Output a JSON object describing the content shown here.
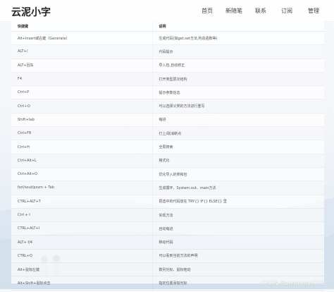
{
  "header": {
    "site_title": "云泥小字",
    "nav": [
      "首页",
      "新随笔",
      "联系",
      "订阅",
      "管理"
    ]
  },
  "table": {
    "columns": [
      "快捷键",
      "说明"
    ],
    "rows": [
      [
        "Alt+Insert或右键（Generate）",
        "生成代码(如get,set方法,构造函数等)"
      ],
      [
        "ALT+/",
        "代码提示"
      ],
      [
        "ALT+回车",
        "导入包,自动修正"
      ],
      [
        "F4",
        "打开类型层次结构"
      ],
      [
        "Ctrl+P",
        "提示参数信息"
      ],
      [
        "Ctrl＋O",
        "可以选择父类的方法进行重写"
      ],
      [
        "Shift+tab",
        "缩进"
      ],
      [
        "Ctrl+F8",
        "打上/取消断点"
      ],
      [
        "Ctrl+H",
        "全局搜索"
      ],
      [
        "Ctrl+Alt+L",
        "格式化"
      ],
      [
        "Ctrl+Alt+O",
        "优化导入的类和包"
      ],
      [
        "fori/sout/psvm + Tab",
        "生成循环、System.out、main方法"
      ],
      [
        "CTRL+ALT+T",
        "把选中的代码放在 TRY{} IF{} ELSE{} 里"
      ],
      [
        "Ctrl + I",
        "实现方法"
      ],
      [
        "CTRL+ALT+I",
        "自动缩进"
      ],
      [
        "ALT+ f/4",
        "移动代码"
      ],
      [
        "CTRL+Q",
        "可以看到当前方法的声明"
      ],
      [
        "Alt+鼠标左键",
        "数列光标、鼠标拖动"
      ],
      [
        "Alt+Shift+鼠标点击",
        "指定位置添加光标"
      ]
    ]
  },
  "watermark": "CSDN @zhangsan3333"
}
